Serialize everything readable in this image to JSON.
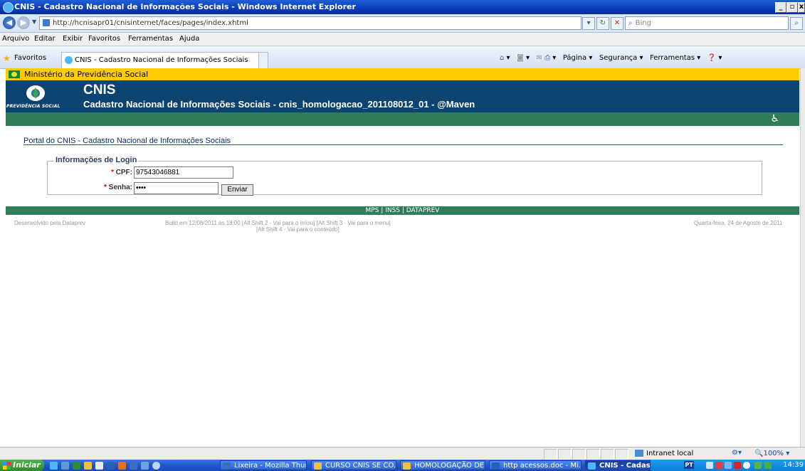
{
  "window": {
    "title": "CNIS - Cadastro Nacional de Informações Sociais - Windows Internet Explorer"
  },
  "browser": {
    "address": "http://hcnisapr01/cnisinternet/faces/pages/index.xhtml",
    "search_placeholder": "Bing",
    "menu": [
      "Arquivo",
      "Editar",
      "Exibir",
      "Favoritos",
      "Ferramentas",
      "Ajuda"
    ],
    "favorites_label": "Favoritos",
    "tab_title": "CNIS - Cadastro Nacional de Informações Sociais",
    "commands": {
      "page": "Página",
      "security": "Segurança",
      "tools": "Ferramentas"
    }
  },
  "page": {
    "ministry": "Ministério da Previdência Social",
    "logo_text": "PREVIDÊNCIA SOCIAL",
    "app_name": "CNIS",
    "app_subtitle": "Cadastro Nacional de Informações Sociais - cnis_homologacao_201108012_01 - @Maven",
    "portal_title": "Portal do CNIS - Cadastro Nacional de Informações Sociais",
    "login": {
      "legend": "Informações de Login",
      "cpf_label": "CPF:",
      "cpf_value": "97543046881",
      "password_label": "Senha:",
      "password_value": "••••",
      "submit": "Enviar",
      "required_mark": "*"
    },
    "footer": {
      "links": "MPS | INSS | DATAPREV",
      "developed_by": "Desenvolvido pela Dataprev",
      "build": "Build em 12/08/2011 às 18:00 [Alt Shift 2 - Vai para o início]    [Alt Shift 3 - Vai para o menu]",
      "shortcut": "[Alt Shift 4 - Vai para o conteúdo]",
      "date": "Quarta-feira, 24 de Agosto de 2011"
    }
  },
  "statusbar": {
    "zone": "Intranet local",
    "zoom": "100%"
  },
  "taskbar": {
    "start": "Iniciar",
    "items": [
      {
        "label": "Lixeira - Mozilla Thun...",
        "color": "#3a6fc4"
      },
      {
        "label": "CURSO CNIS SE CO...",
        "color": "#f0c040"
      },
      {
        "label": "HOMOLOGAÇÃO DE...",
        "color": "#f0c040"
      },
      {
        "label": "http acessos.doc - Mi...",
        "color": "#2b5fb8"
      },
      {
        "label": "CNIS - Cadastro Na...",
        "color": "#4db6ff"
      }
    ],
    "lang": "PT",
    "clock": "14:39"
  }
}
